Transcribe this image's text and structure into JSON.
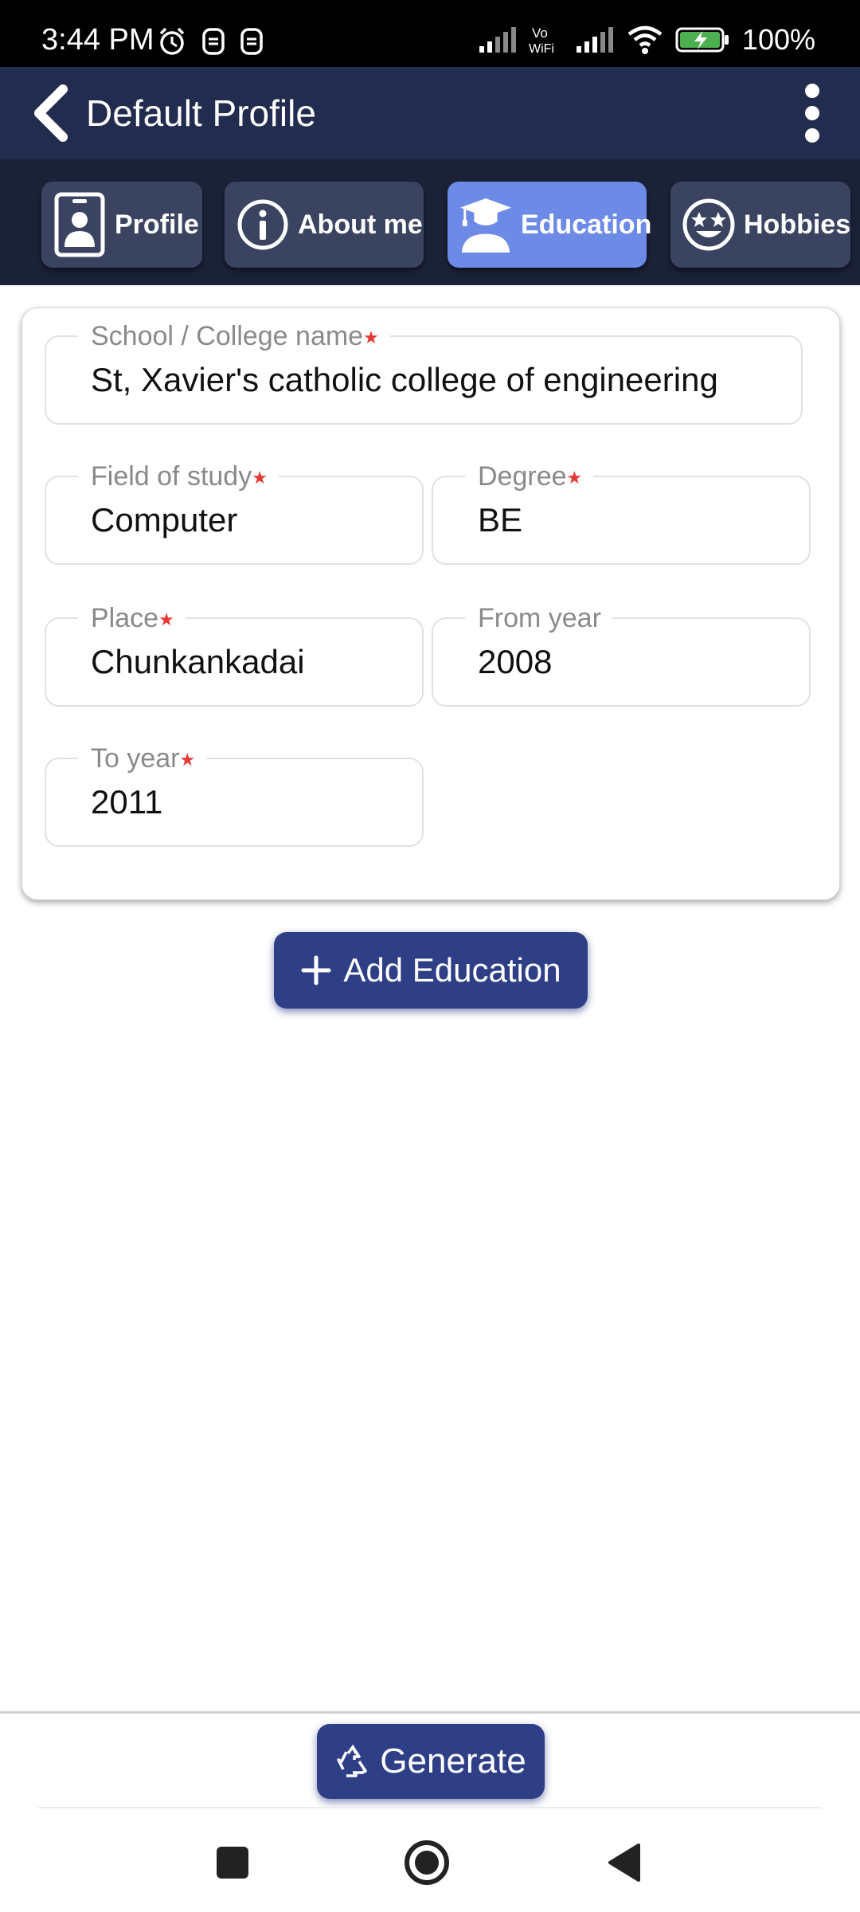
{
  "status_bar": {
    "time": "3:44 PM",
    "battery": "100%",
    "icons": [
      "alarm-icon",
      "sim-icon",
      "sim-icon",
      "signal-icon",
      "vowifi-icon",
      "signal-icon",
      "wifi-icon",
      "battery-charging-icon"
    ]
  },
  "app_bar": {
    "title": "Default Profile"
  },
  "tabs": [
    {
      "label": "Profile",
      "icon": "id-badge-icon",
      "active": false
    },
    {
      "label": "About me",
      "icon": "info-icon",
      "active": false
    },
    {
      "label": "Education",
      "icon": "graduate-icon",
      "active": true
    },
    {
      "label": "Hobbies",
      "icon": "star-eyes-icon",
      "active": false
    }
  ],
  "education_form": {
    "school": {
      "label": "School / College name",
      "value": "St, Xavier's catholic college of engineering",
      "required": true
    },
    "field_of_study": {
      "label": "Field of study",
      "value": "Computer",
      "required": true
    },
    "degree": {
      "label": "Degree",
      "value": "BE",
      "required": true
    },
    "place": {
      "label": "Place",
      "value": "Chunkankadai",
      "required": true
    },
    "from_year": {
      "label": "From year",
      "value": "2008",
      "required": false
    },
    "to_year": {
      "label": "To year",
      "value": "2011",
      "required": true
    }
  },
  "add_button": {
    "label": "Add Education"
  },
  "generate_button": {
    "label": "Generate"
  },
  "colors": {
    "app_bar": "#222c4e",
    "tab_strip": "#1b2238",
    "tab_active": "#6c8ae6",
    "primary_button": "#2f3f86",
    "required_star": "#e53935"
  }
}
